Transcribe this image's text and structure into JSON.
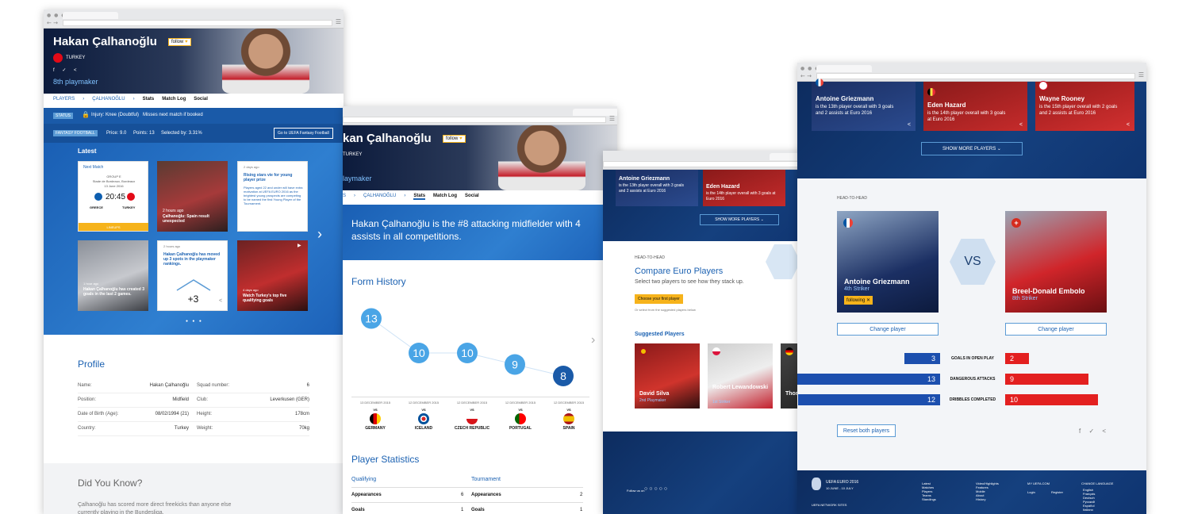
{
  "colors": {
    "blue": "#1c62b2",
    "red": "#e32020",
    "navy": "#0d2c5f",
    "gold": "#f6b31b"
  },
  "w1": {
    "name": "Hakan Çalhanoğlu",
    "follow": "follow",
    "country": "TURKEY",
    "rank": "8th playmaker",
    "breadcrumb": {
      "players": "PLAYERS",
      "player": "ÇALHANOĞLU",
      "tabs": [
        "Stats",
        "Match Log",
        "Social"
      ]
    },
    "status": {
      "label": "STATUS",
      "text": "Injury: Knee (Doubtful)   Misses next match if booked"
    },
    "fantasy": {
      "label": "FANTASY FOOTBALL",
      "price": "Price: 9.0",
      "points": "Points: 13",
      "selected": "Selected by: 3.31%",
      "button": "Go to UEFA Fantasy Football"
    },
    "latest": "Latest",
    "match": {
      "header": "Next Match",
      "group": "GROUP E",
      "venue": "Stade de Bordeaux, Bordeaux",
      "date": "13 June 2016",
      "time": "20:45",
      "home": "GREECE",
      "away": "TURKEY",
      "cta": "LINEUPS"
    },
    "news": [
      {
        "time": "2 hours ago",
        "title": "Çalhanoğlu: Spain result unexpected"
      },
      {
        "time": "2 days ago",
        "title": "Rising stars vie for young player prize",
        "body": "Players aged 22 and under will have extra motivation at UEFA EURO 2016 as the brightest young prospects are competing to be named the first Young Player of the Tournament."
      },
      {
        "time": "1 hour ago",
        "title": "Hakan Çalhanoğlu has created 3 goals in the last 2 games."
      },
      {
        "time": "2 hours ago",
        "title": "Hakan Çalhanoğlu has moved up 3 spots in the playmaker rankings.",
        "delta": "+3"
      },
      {
        "time": "4 days ago",
        "title": "Watch Turkey's top five qualifying goals"
      }
    ],
    "profile": {
      "title": "Profile",
      "rows": [
        {
          "l": "Name:",
          "v": "Hakan Çalhanoğlu",
          "l2": "Squad number:",
          "v2": "6"
        },
        {
          "l": "Position:",
          "v": "Midfield",
          "l2": "Club:",
          "v2": "Leverkusen (GER)"
        },
        {
          "l": "Date of Birth (Age):",
          "v": "08/02/1994 (21)",
          "l2": "Height:",
          "v2": "178cm"
        },
        {
          "l": "Country:",
          "v": "Turkey",
          "l2": "Weight:",
          "v2": "70kg"
        }
      ]
    },
    "dyk": {
      "title": "Did You Know?",
      "text": "Çalhanoğlu has scored more direct freekicks than anyone else currently playing in the Bundesliga."
    }
  },
  "w2": {
    "name": "kan Çalhanoğlu",
    "follow": "follow",
    "country": "TURKEY",
    "rank": "laymaker",
    "breadcrumb": {
      "players": "S",
      "player": "ÇALHANOĞLU",
      "tabs": [
        "Stats",
        "Match Log",
        "Social"
      ]
    },
    "headline": "Hakan Çalhanoğlu is the #8 attacking midfielder with 4 assists in all competitions.",
    "form": {
      "title": "Form History",
      "values": [
        13,
        10,
        10,
        9,
        8
      ],
      "matches": [
        {
          "date": "13 DECEMBER 2015",
          "vs": "VS",
          "team": "GERMANY"
        },
        {
          "date": "12 DECEMBER 2015",
          "vs": "VS",
          "team": "ICELAND"
        },
        {
          "date": "12 DECEMBER 2015",
          "vs": "VS",
          "team": "CZECH REPUBLIC"
        },
        {
          "date": "12 DECEMBER 2015",
          "vs": "VS",
          "team": "PORTUGAL"
        },
        {
          "date": "12 DECEMBER 2015",
          "vs": "VS",
          "team": "SPAIN"
        }
      ]
    },
    "stats": {
      "title": "Player Statistics",
      "q": "Qualifying",
      "t": "Tournament",
      "rows": [
        {
          "l": "Appearances",
          "q": "6",
          "t": "2"
        },
        {
          "l": "Goals",
          "q": "1",
          "t": "1"
        }
      ]
    }
  },
  "w3": {
    "players": [
      {
        "name": "Antoine Griezmann",
        "desc": "is the 13th player overall with 3 goals and 2 assists at Euro 2016"
      },
      {
        "name": "Eden Hazard",
        "desc": "is the 14th player overall with 3 goals at Euro 2016"
      }
    ],
    "more": "SHOW MORE PLAYERS",
    "h2h": "HEAD-TO-HEAD",
    "title": "Compare Euro Players",
    "sub": "Select two players to see how they stack up.",
    "choose": "Choose your first player",
    "or": "Or select from the suggested players below",
    "suggested": "Suggested Players",
    "sugg": [
      {
        "name": "David Silva",
        "pos": "2nd Playmaker"
      },
      {
        "name": "Robert Lewandowski",
        "pos": "1st Striker"
      },
      {
        "name": "Thom",
        "pos": ""
      }
    ],
    "follow": "Follow us on"
  },
  "w4": {
    "players": [
      {
        "name": "Antoine Griezmann",
        "desc": "is the 13th player overall with 3 goals and 2 assists at Euro 2016"
      },
      {
        "name": "Eden Hazard",
        "desc": "is the 14th player overall with 3 goals at Euro 2016"
      },
      {
        "name": "Wayne Rooney",
        "desc": "is the 15th player overall with 2 goals and 2 assists at Euro 2016"
      }
    ],
    "more": "SHOW MORE PLAYERS",
    "h2h": "HEAD-TO-HEAD",
    "vs": "VS",
    "p1": {
      "name": "Antoine Griezmann",
      "pos": "4th Striker",
      "following": "following ✕"
    },
    "p2": {
      "name": "Breel-Donald Embolo",
      "pos": "8th Striker"
    },
    "change": "Change player",
    "compare": [
      {
        "label": "GOALS IN OPEN PLAY",
        "a": 3,
        "b": 2
      },
      {
        "label": "DANGEROUS ATTACKS",
        "a": 13,
        "b": 9
      },
      {
        "label": "DRIBBLES COMPLETED",
        "a": 12,
        "b": 10
      }
    ],
    "reset": "Reset both players",
    "footer": {
      "brand": "UEFA EURO 2016",
      "dates": "10 JUNE - 10 JULY",
      "network": "UEFA NETWORK SITES",
      "col1": [
        "Latest",
        "Matches",
        "Players",
        "Teams",
        "Standings"
      ],
      "col2": [
        "Video/Highlights",
        "Features",
        "Mobile",
        "About",
        "History"
      ],
      "myuefa": "MY UEFA.COM",
      "login": "Login",
      "register": "Register",
      "lang": "CHANGE LANGUAGE",
      "langs": [
        "English",
        "Français",
        "Deutsch",
        "Русский",
        "Español",
        "Italiano"
      ]
    }
  }
}
